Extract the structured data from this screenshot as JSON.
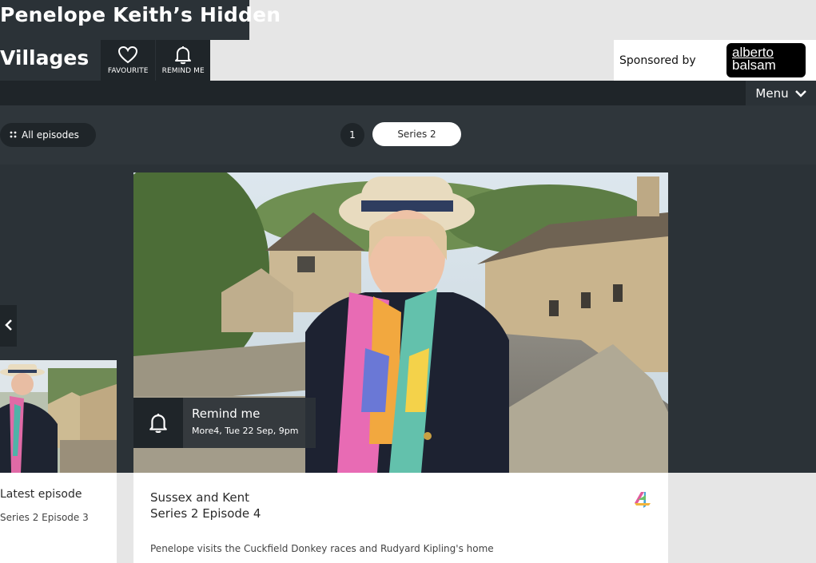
{
  "programme": {
    "title_line1": "Penelope Keith’s Hidden",
    "title_line2": "Villages"
  },
  "header_actions": {
    "favourite_label": "FAVOURITE",
    "remind_label": "REMIND ME"
  },
  "sponsor": {
    "text": "Sponsored by",
    "logo_line1": "alberto",
    "logo_line2": "balsam"
  },
  "nav": {
    "menu_label": "Menu"
  },
  "series_bar": {
    "all_episodes_label": "All episodes",
    "series_number": "1",
    "selected_series": "Series 2"
  },
  "hero": {
    "remind_title": "Remind me",
    "remind_detail": "More4, Tue 22 Sep, 9pm"
  },
  "episode": {
    "title": "Sussex and Kent",
    "subtitle": "Series 2 Episode 4",
    "description": "Penelope visits the Cuckfield Donkey races and Rudyard Kipling's home"
  },
  "left_card": {
    "label": "Latest episode",
    "sublabel": "Series 2 Episode 3"
  },
  "icons": {
    "favourite": "heart-icon",
    "remind": "bell-icon",
    "menu": "chevron-down-icon",
    "all_episodes": "grid-dots-icon",
    "prev": "chevron-left-icon",
    "channel": "channel4-logo-icon"
  },
  "colors": {
    "dark": "#2b3237",
    "darker": "#1f2529",
    "light": "#e6e6e6"
  }
}
